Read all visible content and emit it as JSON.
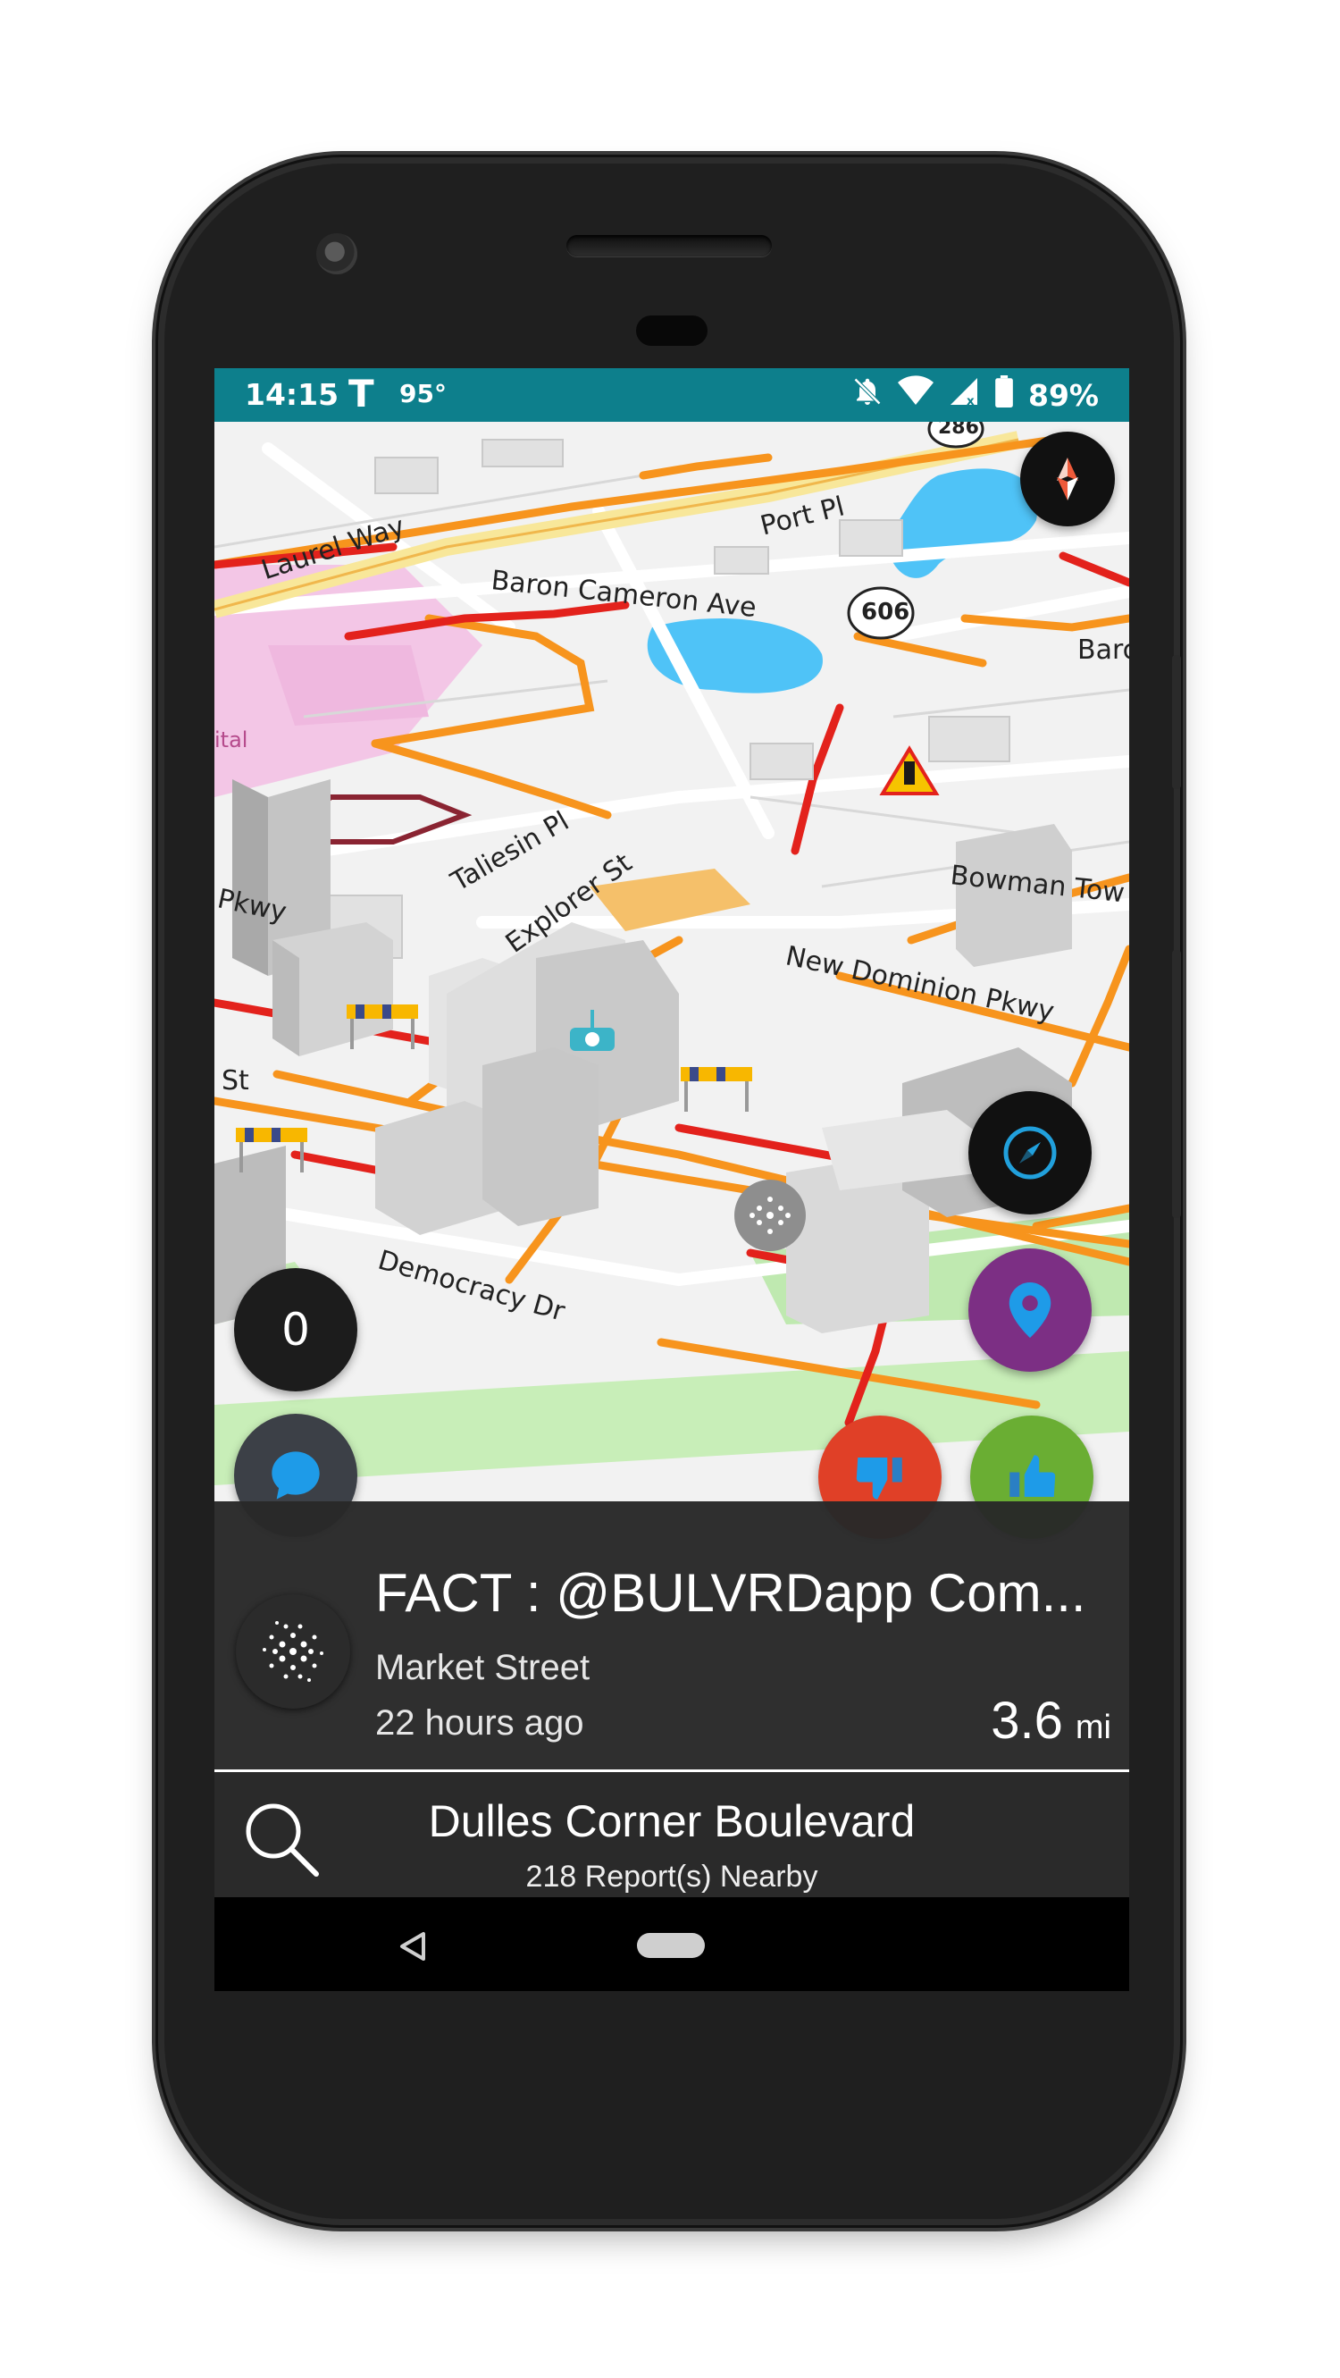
{
  "status_bar": {
    "time": "14:15",
    "carrier_icon": "T",
    "temperature": "95°",
    "battery": "89%",
    "icons": [
      "notifications-off-icon",
      "wifi-icon",
      "cell-signal-icon",
      "battery-icon"
    ]
  },
  "map": {
    "labels": {
      "laurel_way": "Laurel Way",
      "baron_cameron": "Baron Cameron Ave",
      "port_pl": "Port Pl",
      "route_606": "606",
      "route_286": "286",
      "barc": "Barc",
      "taliesin": "Taliesin Pl",
      "explorer": "Explorer St",
      "bowman": "Bowman Tow",
      "new_dominion": "New Dominion Pkwy",
      "pkwy": "Pkwy",
      "st": "St",
      "democracy": "Democracy Dr",
      "hospital": "ital"
    }
  },
  "counter_button": {
    "value": "0"
  },
  "report_card": {
    "title": "FACT : @BULVRDapp Com...",
    "street": "Market Street",
    "time_ago": "22 hours ago",
    "distance": "3.6",
    "distance_unit": "mi"
  },
  "search_bar": {
    "place": "Dulles Corner Boulevard",
    "reports_nearby": "218 Report(s) Nearby"
  },
  "colors": {
    "status_bar": "#0d7f8c",
    "thumbs_down": "#e04027",
    "thumbs_up": "#6aae33",
    "location": "#7c2f84",
    "fab_dark": "#1c1c1c",
    "compass_blue": "#21a0dc"
  }
}
